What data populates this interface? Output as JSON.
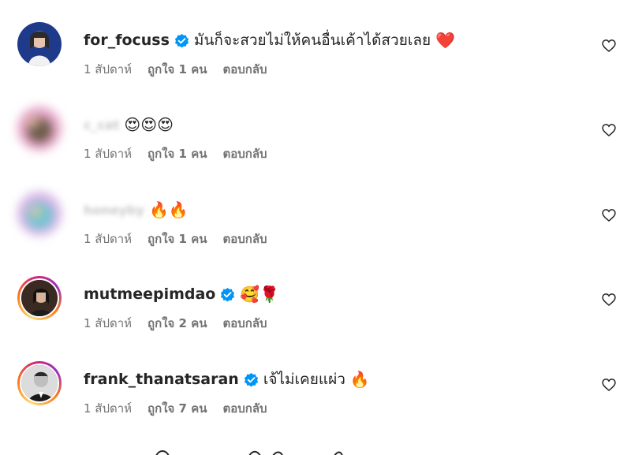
{
  "comments": [
    {
      "username": "for_focuss",
      "verified": true,
      "text": "มันก็จะสวยไม่ให้คนอื่นเค้าได้สวยเลย",
      "emoji": "❤️",
      "time": "1 สัปดาห์",
      "likes": "ถูกใจ 1 คน",
      "reply": "ตอบกลับ"
    },
    {
      "username": "c_cat",
      "verified": false,
      "text": "",
      "emoji": "😍😍😍",
      "time": "1 สัปดาห์",
      "likes": "ถูกใจ 1 คน",
      "reply": "ตอบกลับ"
    },
    {
      "username": "honeyby",
      "verified": false,
      "text": "",
      "emoji": "🔥🔥",
      "time": "1 สัปดาห์",
      "likes": "ถูกใจ 1 คน",
      "reply": "ตอบกลับ"
    },
    {
      "username": "mutmeepimdao",
      "verified": true,
      "text": "",
      "emoji": "🥰🌹",
      "time": "1 สัปดาห์",
      "likes": "ถูกใจ 2 คน",
      "reply": "ตอบกลับ"
    },
    {
      "username": "frank_thanatsaran",
      "verified": true,
      "text": "เจ้ไม่เคยแผ่ว",
      "emoji": "🔥",
      "time": "1 สัปดาห์",
      "likes": "ถูกใจ 7 คน",
      "reply": "ตอบกลับ"
    }
  ],
  "colors": {
    "text": "#262626",
    "secondary": "#737373",
    "verified": "#0095f6"
  },
  "icons": [
    "verified-badge-icon",
    "heart-outline-icon"
  ]
}
